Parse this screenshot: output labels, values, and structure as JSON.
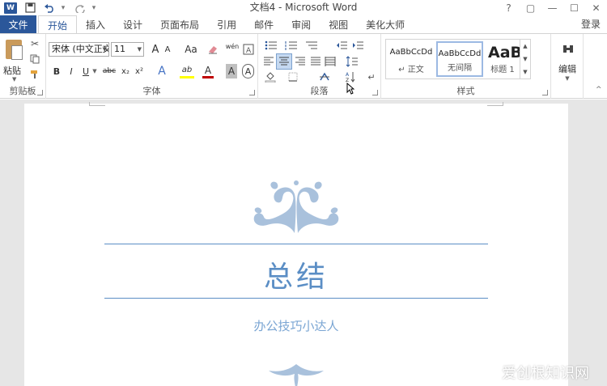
{
  "window": {
    "title": "文档4 - Microsoft Word",
    "logo": "W",
    "controls": [
      "?",
      "▢",
      "—",
      "☐",
      "✕"
    ]
  },
  "qat": {
    "save_icon": "save-icon",
    "undo_icon": "undo-icon",
    "redo_icon": "redo-icon"
  },
  "tabs": {
    "file": "文件",
    "items": [
      "开始",
      "插入",
      "设计",
      "页面布局",
      "引用",
      "邮件",
      "审阅",
      "视图",
      "美化大师"
    ],
    "login": "登录"
  },
  "ribbon": {
    "clipboard": {
      "label": "剪贴板",
      "paste": "粘贴"
    },
    "font": {
      "label": "字体",
      "font_name": "宋体 (中文正文)",
      "font_size": "11",
      "grow": "A",
      "aa": "Aa",
      "wen": "wén",
      "bold": "B",
      "italic": "I",
      "underline": "U",
      "strike": "abc",
      "sub": "x₂",
      "sup": "x²",
      "text_a": "A",
      "highlight": "ab",
      "color_a": "A",
      "shade_a": "A",
      "box_a": "A"
    },
    "paragraph": {
      "label": "段落"
    },
    "styles": {
      "label": "样式",
      "items": [
        {
          "preview": "AaBbCcDd",
          "name": "↵ 正文"
        },
        {
          "preview": "AaBbCcDd",
          "name": "无间隔"
        },
        {
          "preview": "AaBb",
          "name": "标题 1"
        }
      ]
    },
    "editing": {
      "label": "编辑"
    }
  },
  "document": {
    "title": "总结",
    "subtitle": "办公技巧小达人"
  },
  "watermark": "爱创根知识网",
  "colors": {
    "brand": "#2b579a",
    "accent": "#5b8ec5",
    "ornament": "#a9c1dc"
  }
}
